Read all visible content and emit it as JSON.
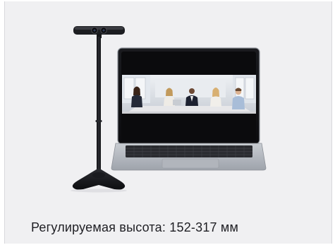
{
  "caption": "Регулируемая высота: 152-317 мм",
  "colors": {
    "background": "#f0f0f2",
    "stand": "#1c1d21",
    "laptop_body": "#b7bbc2",
    "keyboard": "#2a2b30",
    "screen_bezel": "#111114",
    "room_wall": "#d9dde3"
  },
  "illustration": {
    "camera_stand": "camera-on-tripod-stand",
    "laptop": "laptop-with-video-call"
  }
}
